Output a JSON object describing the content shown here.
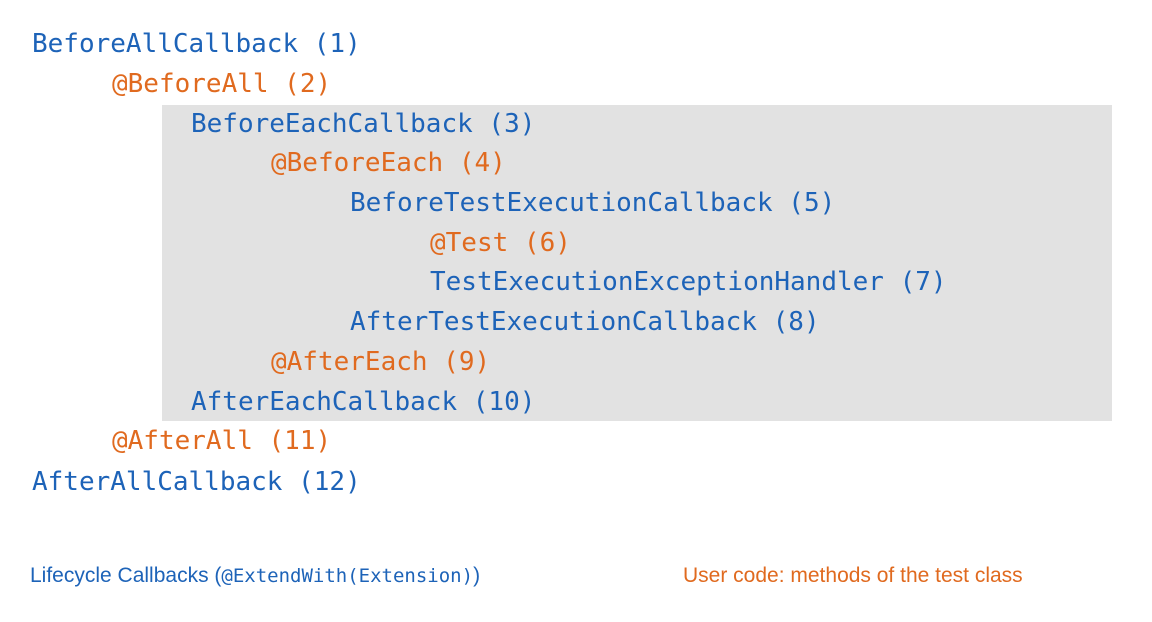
{
  "diagram": {
    "colors": {
      "extension": "#1d63b8",
      "user_code": "#e06a1f",
      "box_background": "#e2e2e2"
    },
    "steps": [
      {
        "text": "BeforeAllCallback (1)",
        "kind": "extension"
      },
      {
        "text": "@BeforeAll (2)",
        "kind": "user"
      },
      {
        "text": "BeforeEachCallback (3)",
        "kind": "extension"
      },
      {
        "text": "@BeforeEach (4)",
        "kind": "user"
      },
      {
        "text": "BeforeTestExecutionCallback (5)",
        "kind": "extension"
      },
      {
        "text": "@Test (6)",
        "kind": "user"
      },
      {
        "text": "TestExecutionExceptionHandler (7)",
        "kind": "extension"
      },
      {
        "text": "AfterTestExecutionCallback (8)",
        "kind": "extension"
      },
      {
        "text": "@AfterEach (9)",
        "kind": "user"
      },
      {
        "text": "AfterEachCallback (10)",
        "kind": "extension"
      },
      {
        "text": "@AfterAll (11)",
        "kind": "user"
      },
      {
        "text": "AfterAllCallback (12)",
        "kind": "extension"
      }
    ]
  },
  "legend": {
    "extension_prefix": "Lifecycle Callbacks (",
    "extension_code": "@ExtendWith(Extension)",
    "extension_suffix": ")",
    "user_label": "User code: methods of the test class"
  }
}
